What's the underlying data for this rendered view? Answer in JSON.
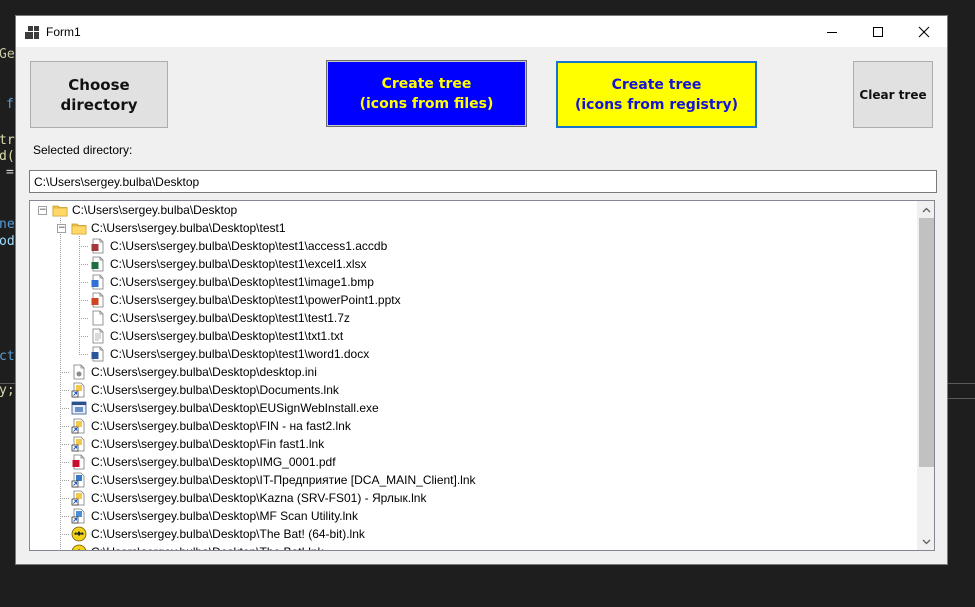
{
  "background": {
    "code_fragments": [
      "Ge",
      "f",
      "tr",
      "d(",
      "=",
      "ne",
      "od",
      "ct",
      "y;"
    ]
  },
  "window": {
    "title": "Form1",
    "title_icon": "winforms-app-icon",
    "controls": [
      "minimize-icon",
      "maximize-icon",
      "close-icon"
    ]
  },
  "buttons": {
    "choose": {
      "line1": "Choose",
      "line2": "directory"
    },
    "from_files": {
      "line1": "Create tree",
      "line2": "(icons from files)"
    },
    "from_registry": {
      "line1": "Create tree",
      "line2": "(icons from registry)"
    },
    "clear": {
      "label": "Clear tree"
    }
  },
  "selected_directory": {
    "label": "Selected directory:",
    "value": "C:\\Users\\sergey.bulba\\Desktop"
  },
  "tree": {
    "nodes": [
      {
        "label": "C:\\Users\\sergey.bulba\\Desktop",
        "level": 0,
        "icon": "folder-icon",
        "expanded": true
      },
      {
        "label": "C:\\Users\\sergey.bulba\\Desktop\\test1",
        "level": 1,
        "icon": "folder-icon",
        "expanded": true
      },
      {
        "label": "C:\\Users\\sergey.bulba\\Desktop\\test1\\access1.accdb",
        "level": 2,
        "icon": "access-file-icon"
      },
      {
        "label": "C:\\Users\\sergey.bulba\\Desktop\\test1\\excel1.xlsx",
        "level": 2,
        "icon": "excel-file-icon"
      },
      {
        "label": "C:\\Users\\sergey.bulba\\Desktop\\test1\\image1.bmp",
        "level": 2,
        "icon": "image-file-icon"
      },
      {
        "label": "C:\\Users\\sergey.bulba\\Desktop\\test1\\powerPoint1.pptx",
        "level": 2,
        "icon": "powerpoint-file-icon"
      },
      {
        "label": "C:\\Users\\sergey.bulba\\Desktop\\test1\\test1.7z",
        "level": 2,
        "icon": "blank-file-icon"
      },
      {
        "label": "C:\\Users\\sergey.bulba\\Desktop\\test1\\txt1.txt",
        "level": 2,
        "icon": "text-file-icon"
      },
      {
        "label": "C:\\Users\\sergey.bulba\\Desktop\\test1\\word1.docx",
        "level": 2,
        "icon": "word-file-icon"
      },
      {
        "label": "C:\\Users\\sergey.bulba\\Desktop\\desktop.ini",
        "level": 1,
        "icon": "settings-file-icon"
      },
      {
        "label": "C:\\Users\\sergey.bulba\\Desktop\\Documents.lnk",
        "level": 1,
        "icon": "shortcut-icon"
      },
      {
        "label": "C:\\Users\\sergey.bulba\\Desktop\\EUSignWebInstall.exe",
        "level": 1,
        "icon": "exe-icon"
      },
      {
        "label": "C:\\Users\\sergey.bulba\\Desktop\\FIN - на fast2.lnk",
        "level": 1,
        "icon": "shortcut-icon"
      },
      {
        "label": "C:\\Users\\sergey.bulba\\Desktop\\Fin fast1.lnk",
        "level": 1,
        "icon": "shortcut-icon"
      },
      {
        "label": "C:\\Users\\sergey.bulba\\Desktop\\IMG_0001.pdf",
        "level": 1,
        "icon": "pdf-file-icon"
      },
      {
        "label": "C:\\Users\\sergey.bulba\\Desktop\\IT-Предприятие [DCA_MAIN_Client].lnk",
        "level": 1,
        "icon": "shortcut-app-icon"
      },
      {
        "label": "C:\\Users\\sergey.bulba\\Desktop\\Kazna (SRV-FS01) - Ярлык.lnk",
        "level": 1,
        "icon": "shortcut-icon"
      },
      {
        "label": "C:\\Users\\sergey.bulba\\Desktop\\MF Scan Utility.lnk",
        "level": 1,
        "icon": "scanner-shortcut-icon"
      },
      {
        "label": "C:\\Users\\sergey.bulba\\Desktop\\The Bat! (64-bit).lnk",
        "level": 1,
        "icon": "thebat-shortcut-icon"
      },
      {
        "label": "C:\\Users\\sergey.bulba\\Desktop\\The Bat!.lnk",
        "level": 1,
        "icon": "thebat-shortcut-icon",
        "partially_visible": true
      }
    ]
  },
  "colors": {
    "from_files_bg": "#0000ff",
    "from_files_text": "#ffff00",
    "from_registry_bg": "#ffff00",
    "from_registry_text": "#1414d2",
    "from_registry_border": "#1874cd",
    "folder": "#f4c84a"
  }
}
